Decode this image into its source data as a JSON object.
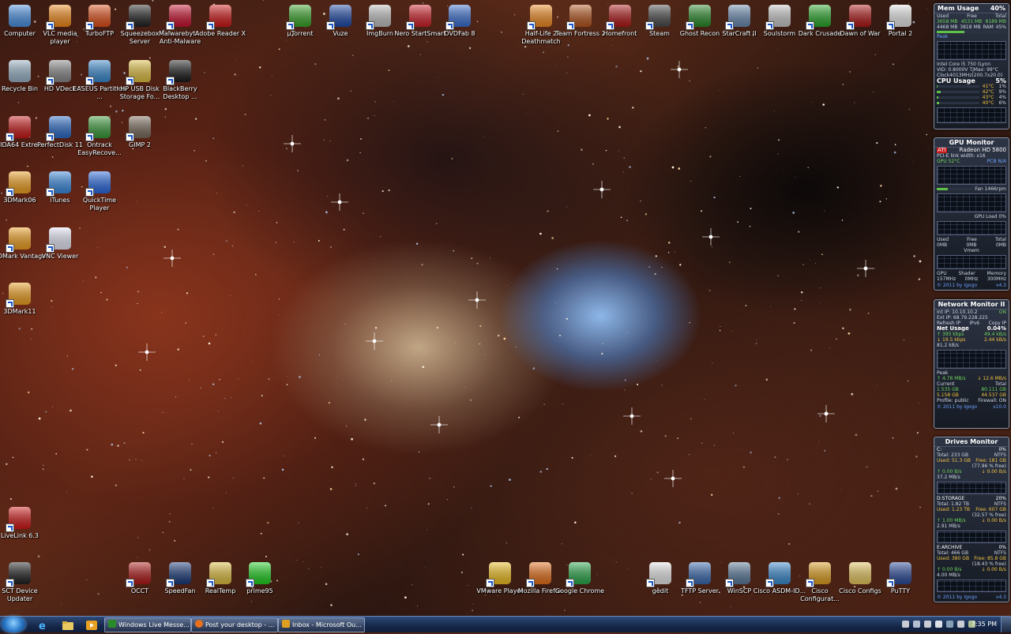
{
  "desktop_icons": [
    {
      "label": "Computer",
      "icon": "computer-icon",
      "color": "#4a90e2"
    },
    {
      "label": "VLC media player",
      "icon": "vlc-icon",
      "color": "#f28a1a"
    },
    {
      "label": "TurboFTP",
      "icon": "turboftp-icon",
      "color": "#e0501a"
    },
    {
      "label": "Squeezebox Server",
      "icon": "squeezebox-icon",
      "color": "#222222"
    },
    {
      "label": "Malwarebyt... Anti-Malware",
      "icon": "malwarebytes-icon",
      "color": "#c8102e"
    },
    {
      "label": "Adobe Reader X",
      "icon": "adobe-reader-icon",
      "color": "#d01717"
    },
    {
      "label": "µTorrent",
      "icon": "utorrent-icon",
      "color": "#3aa52a"
    },
    {
      "label": "Vuze",
      "icon": "vuze-icon",
      "color": "#1f4aa8"
    },
    {
      "label": "ImgBurn",
      "icon": "imgburn-icon",
      "color": "#c0c0c0"
    },
    {
      "label": "Nero StartSmart",
      "icon": "nero-icon",
      "color": "#d0202a"
    },
    {
      "label": "DVDFab 8",
      "icon": "dvdfab-icon",
      "color": "#3a6fd0"
    },
    {
      "label": "Half-Life 2 Deathmatch",
      "icon": "half-life-icon",
      "color": "#f08a20"
    },
    {
      "label": "Team Fortress 2",
      "icon": "team-fortress-icon",
      "color": "#b6571f"
    },
    {
      "label": "Homefront",
      "icon": "homefront-icon",
      "color": "#b01818"
    },
    {
      "label": "Steam",
      "icon": "steam-icon",
      "color": "#4a4a4a"
    },
    {
      "label": "Ghost Recon",
      "icon": "ghost-recon-icon",
      "color": "#2a8a2a"
    },
    {
      "label": "StarCraft II",
      "icon": "starcraft-icon",
      "color": "#6a8ab0"
    },
    {
      "label": "Soulstorm",
      "icon": "soulstorm-icon",
      "color": "#c8c8c8"
    },
    {
      "label": "Dark Crusade",
      "icon": "dark-crusade-icon",
      "color": "#2aa82a"
    },
    {
      "label": "Dawn of War",
      "icon": "dawn-of-war-icon",
      "color": "#b01818"
    },
    {
      "label": "Portal 2",
      "icon": "portal-icon",
      "color": "#e8e8e8"
    },
    {
      "label": "Recycle Bin",
      "icon": "recycle-bin-icon",
      "color": "#9ab4c8"
    },
    {
      "label": "HD VDeck",
      "icon": "hd-vdeck-icon",
      "color": "#888888"
    },
    {
      "label": "EASEUS Partition ...",
      "icon": "easeus-icon",
      "color": "#3a8ad0"
    },
    {
      "label": "HP USB Disk Storage Fo...",
      "icon": "hp-usb-icon",
      "color": "#e0c040"
    },
    {
      "label": "BlackBerry Desktop ...",
      "icon": "blackberry-icon",
      "color": "#1a1a1a"
    },
    {
      "label": "AIDA64 Extre...",
      "icon": "aida64-icon",
      "color": "#c81818"
    },
    {
      "label": "PerfectDisk 11",
      "icon": "perfectdisk-icon",
      "color": "#2a6ac8"
    },
    {
      "label": "Ontrack EasyRecove...",
      "icon": "ontrack-icon",
      "color": "#3a9a3a"
    },
    {
      "label": "GIMP 2",
      "icon": "gimp-icon",
      "color": "#7a6a5a"
    },
    {
      "label": "3DMark06",
      "icon": "3dmark06-icon",
      "color": "#f0a020"
    },
    {
      "label": "iTunes",
      "icon": "itunes-icon",
      "color": "#3a8ae0"
    },
    {
      "label": "QuickTime Player",
      "icon": "quicktime-icon",
      "color": "#2a6ae0"
    },
    {
      "label": "3DMark Vantage",
      "icon": "3dmark-vantage-icon",
      "color": "#f0a020"
    },
    {
      "label": "VNC Viewer",
      "icon": "vnc-icon",
      "color": "#e8e8f8"
    },
    {
      "label": "3DMark11",
      "icon": "3dmark11-icon",
      "color": "#f0a020"
    },
    {
      "label": "LiveLink 6.3",
      "icon": "livelink-icon",
      "color": "#d01818"
    },
    {
      "label": "SCT Device Updater",
      "icon": "sct-icon",
      "color": "#202020"
    },
    {
      "label": "OCCT",
      "icon": "occt-icon",
      "color": "#b01818"
    },
    {
      "label": "SpeedFan",
      "icon": "speedfan-icon",
      "color": "#1a3a7a"
    },
    {
      "label": "RealTemp",
      "icon": "realtemp-icon",
      "color": "#e0c040"
    },
    {
      "label": "prime95",
      "icon": "prime95-icon",
      "color": "#20d020"
    },
    {
      "label": "VMware Player",
      "icon": "vmware-icon",
      "color": "#f0c020"
    },
    {
      "label": "Mozilla Firefox",
      "icon": "firefox-icon",
      "color": "#e8701a"
    },
    {
      "label": "Google Chrome",
      "icon": "chrome-icon",
      "color": "#2aa84a"
    },
    {
      "label": "gedit",
      "icon": "gedit-icon",
      "color": "#e8e8e8"
    },
    {
      "label": "TFTP Server",
      "icon": "tftp-icon",
      "color": "#3a6ab0"
    },
    {
      "label": "WinSCP",
      "icon": "winscp-icon",
      "color": "#5a7a9a"
    },
    {
      "label": "Cisco ASDM-ID...",
      "icon": "cisco-asdm-icon",
      "color": "#3a8ad0"
    },
    {
      "label": "Cisco Configurat...",
      "icon": "cisco-config-icon",
      "color": "#e0a020"
    },
    {
      "label": "Cisco Configs",
      "icon": "folder-icon",
      "color": "#e8c860"
    },
    {
      "label": "PuTTY",
      "icon": "putty-icon",
      "color": "#2a4a9a"
    }
  ],
  "gadgets": {
    "mem": {
      "title": "Mem Usage",
      "percent": "40%",
      "headers": [
        "Used",
        "Free",
        "Total"
      ],
      "row1": [
        "3658 MB",
        "4531 MB",
        "8189 MB"
      ],
      "row2": [
        "4468 MB",
        "3818 MB",
        "RAM"
      ],
      "ram_percent": "45%",
      "peak": "Peak",
      "cpu_name": "Intel Core i5 750 (Lynn",
      "vid": "VID: 0.8000V TjMax: 99°C",
      "clock": "Clock4013MHz(200.7x20.0)",
      "cpu_title": "CPU Usage",
      "cpu_percent": "5%",
      "cores": [
        {
          "temp": "41°C",
          "load": "1%"
        },
        {
          "temp": "42°C",
          "load": "9%"
        },
        {
          "temp": "43°C",
          "load": "4%"
        },
        {
          "temp": "40°C",
          "load": "6%"
        }
      ]
    },
    "gpu": {
      "title": "GPU Monitor",
      "card": "Radeon HD 5800",
      "pci": "PCI-E link width: x16",
      "gpu_temp": "GPU 52°C",
      "pcb": "PCB N/A",
      "fan_label": "Fan",
      "fan_value": "1466rpm",
      "load_label": "GPU Load",
      "load_value": "0%",
      "mem_headers": [
        "Used",
        "Free",
        "Total"
      ],
      "mem_values": [
        "0MB",
        "0MB",
        "0MB"
      ],
      "vmem": "Vmem",
      "clock_headers": [
        "GPU",
        "Shader",
        "Memory"
      ],
      "clock_values": [
        "157MHz",
        "0MHz",
        "300MHz"
      ],
      "footer": "© 2011 by Igogo",
      "version": "v4.3"
    },
    "net": {
      "title": "Network Monitor II",
      "int_ip": "Int IP: 10.10.10.2",
      "ext_ip": "Ext IP: 68.79.228.225",
      "status": "ON",
      "refresh": "Refresh IP",
      "ipv6": "IPv6",
      "copy": "Copy IP",
      "usage_title": "Net Usage",
      "usage_value": "0.04%",
      "up_rate": "395 kbps",
      "up_rate2": "49.4 kB/s",
      "down_rate": "19.5 kbps",
      "down_rate2": "2.44 kB/s",
      "graph_label": "81.2 kB/s",
      "peak": "Peak",
      "peak_up": "4.78 MB/s",
      "peak_down": "12.6 MB/s",
      "current": "Current",
      "total": "Total",
      "cur_up": "1.535 GB",
      "tot_up": "80.111 GB",
      "cur_down": "5.158 GB",
      "tot_down": "44.537 GB",
      "profile": "Profile: public",
      "firewall": "Firewall: ON",
      "footer": "© 2011 by Igogo",
      "version": "v10.0"
    },
    "drives": {
      "title": "Drives Monitor",
      "drives": [
        {
          "name": "C:",
          "percent": "0%",
          "total": "Total: 233 GB",
          "fs": "NTFS",
          "used": "Used: 51.3 GB",
          "free": "Free: 181 GB",
          "free_pct": "(77.96 % free)",
          "read": "0.00 B/s",
          "write": "0.00 B/s",
          "graph": "37.2 MB/s"
        },
        {
          "name": "D:STORAGE",
          "percent": "20%",
          "total": "Total: 1.82 TB",
          "fs": "NTFS",
          "used": "Used: 1.23 TB",
          "free": "Free: 607 GB",
          "free_pct": "(32.57 % free)",
          "read": "1.00 MB/s",
          "write": "0.00 B/s",
          "graph": "2.91 MB/s"
        },
        {
          "name": "E:ARCHIVE",
          "percent": "0%",
          "total": "Total: 466 GB",
          "fs": "NTFS",
          "used": "Used: 380 GB",
          "free": "Free: 85.8 GB",
          "free_pct": "(18.43 % free)",
          "read": "0.00 B/s",
          "write": "0.00 B/s",
          "graph": "4.00 MB/s"
        }
      ],
      "footer": "© 2011 by Igogo",
      "version": "v4.3"
    }
  },
  "taskbar": {
    "tasks": [
      {
        "label": "Windows Live Messe...",
        "color": "#2a8a2a"
      },
      {
        "label": "Post your desktop - ...",
        "color": "#e8701a"
      },
      {
        "label": "Inbox - Microsoft Ou...",
        "color": "#e0a020"
      }
    ],
    "quick_launch": [
      "ie-icon",
      "explorer-icon",
      "media-player-icon"
    ],
    "tray_icons": [
      "flag-icon",
      "network-icon",
      "volume-icon",
      "up-arrow-icon",
      "monitor-icon",
      "speaker-icon",
      "power-icon"
    ],
    "clock": "7:35 PM"
  }
}
